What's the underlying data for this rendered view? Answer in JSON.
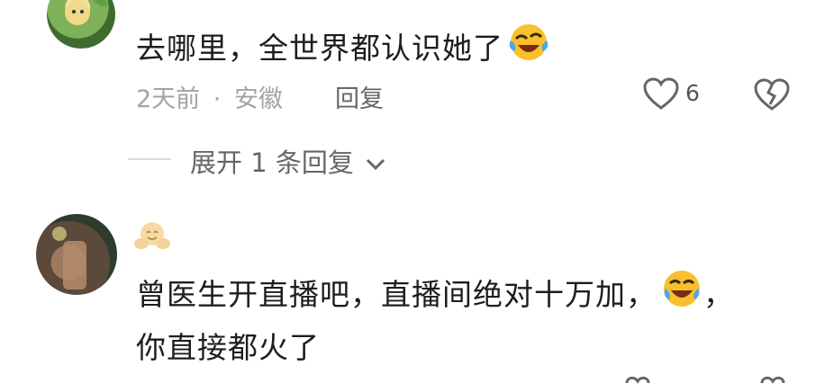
{
  "comments": [
    {
      "text": "去哪里，全世界都认识她了",
      "emoji_icon": "rofl-emoji-icon",
      "time": "2天前",
      "separator": "·",
      "location": "安徽",
      "reply_label": "回复",
      "like_count": "6"
    },
    {
      "text_line1": "曾医生开直播吧，直播间绝对十万加，",
      "emoji_icon": "laughing-tears-emoji-icon",
      "text_line1_suffix": "，",
      "text_line2": "你直接都火了",
      "badge_icon": "hug-emoji-icon"
    }
  ],
  "expand_replies": {
    "label": "展开 1 条回复"
  },
  "colors": {
    "background": "#ffffff",
    "text": "#1d1d1d",
    "meta": "#a3a3a3",
    "icon": "#666666"
  }
}
